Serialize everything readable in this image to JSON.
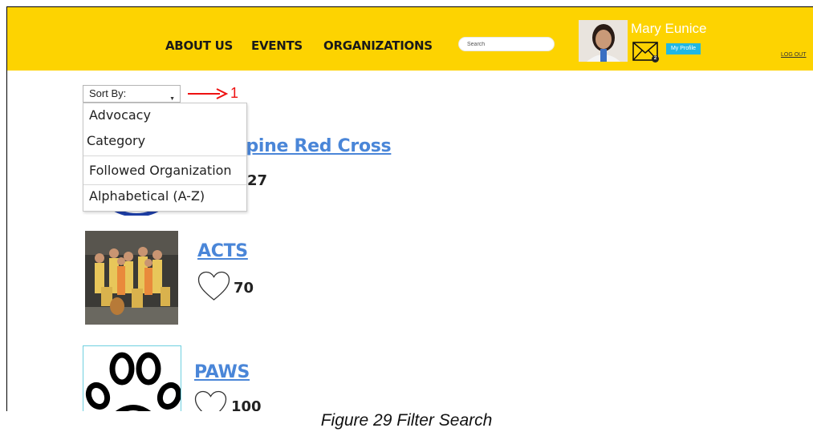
{
  "nav": {
    "links": [
      "ABOUT US",
      "EVENTS",
      "ORGANIZATIONS"
    ],
    "search_placeholder": "Search",
    "username": "Mary Eunice",
    "mail_count": "2",
    "profile_label": "My Profile",
    "logout_label": "LOG OUT"
  },
  "sort": {
    "label": "Sort By:",
    "annotation_number": "1",
    "options": [
      "Advocacy",
      "Category",
      "Followed Organization",
      "Alphabetical (A-Z)"
    ]
  },
  "organizations": [
    {
      "name_visible": "ppine Red Cross",
      "likes_visible": "27"
    },
    {
      "name": "ACTS",
      "likes": "70"
    },
    {
      "name": "PAWS",
      "likes": "100"
    }
  ],
  "caption": "Figure 29 Filter Search",
  "colors": {
    "navbar": "#fdd301",
    "link": "#4a86d8",
    "profile_button": "#21b7e3",
    "annotation": "#e11111"
  }
}
